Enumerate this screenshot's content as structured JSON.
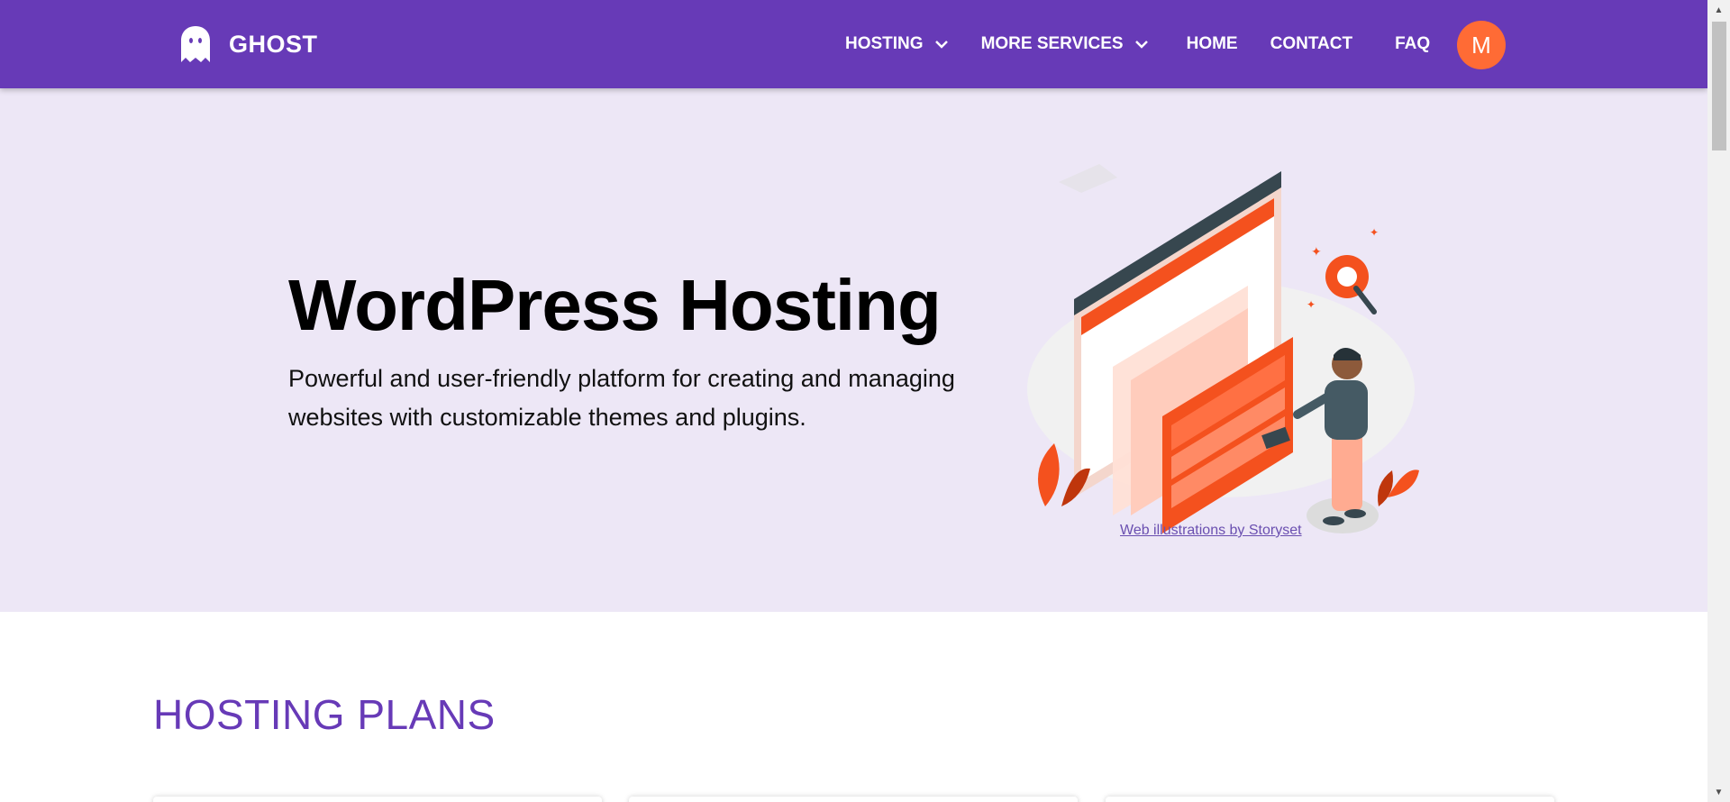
{
  "navbar": {
    "brand": "GHOST",
    "brand_icon": "ghost-icon",
    "items": [
      {
        "label": "HOSTING",
        "dropdown": true
      },
      {
        "label": "MORE SERVICES",
        "dropdown": true
      },
      {
        "label": "HOME",
        "dropdown": false
      },
      {
        "label": "CONTACT",
        "dropdown": false
      },
      {
        "label": "FAQ",
        "dropdown": false
      }
    ],
    "avatar_initial": "M",
    "colors": {
      "navbar": "#673ab7",
      "avatar": "#ff6b35"
    }
  },
  "hero": {
    "title": "WordPress Hosting",
    "description": "Powerful and user-friendly platform for creating and managing websites with customizable themes and plugins.",
    "illustration_icon": "web-developer-illustration",
    "credit_link": "Web illustrations by Storyset",
    "colors": {
      "background": "#ede7f6",
      "illustration_accent": "#f4511e"
    }
  },
  "plans": {
    "title": "HOSTING PLANS",
    "title_color": "#673ab7"
  }
}
